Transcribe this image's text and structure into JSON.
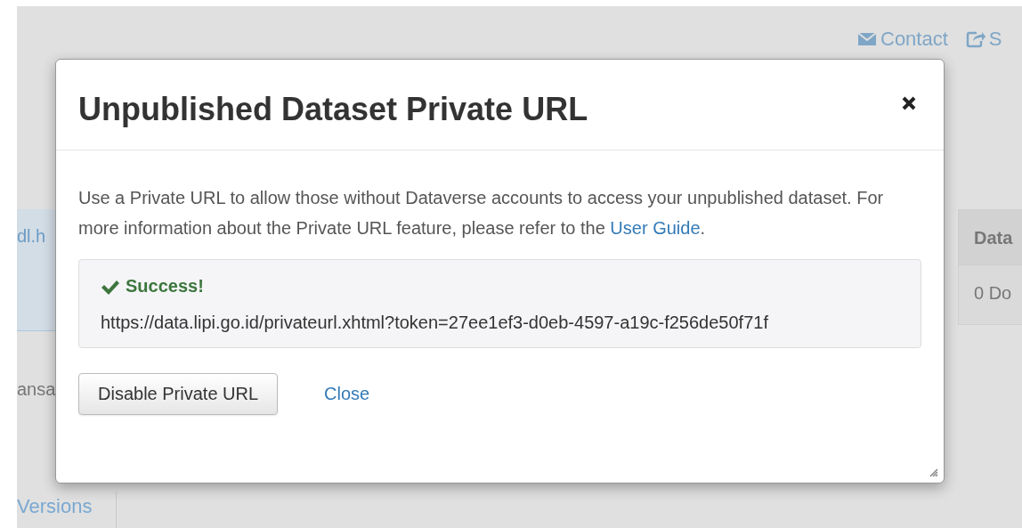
{
  "background": {
    "header_links": [
      {
        "label": "Contact",
        "kind": "envelope"
      },
      {
        "label": "S",
        "kind": "share"
      }
    ],
    "left_texts": [
      "dl.h",
      "ansa"
    ],
    "tab": "Versions",
    "side_panel": {
      "header": "Data",
      "row": "0 Do"
    }
  },
  "modal": {
    "title": "Unpublished Dataset Private URL",
    "body": {
      "text": "Use a Private URL to allow those without Dataverse accounts to access your unpublished dataset. For more information about the Private URL feature, please refer to the ",
      "link": "User Guide",
      "after": "."
    },
    "alert": {
      "kind": "success",
      "title": "Success!",
      "url": "https://data.lipi.go.id/privateurl.xhtml?token=27ee1ef3-d0eb-4597-a19c-f256de50f71f"
    },
    "buttons": [
      {
        "label": "Disable Private URL",
        "kind": "default"
      },
      {
        "label": "Close",
        "kind": "link"
      }
    ]
  }
}
